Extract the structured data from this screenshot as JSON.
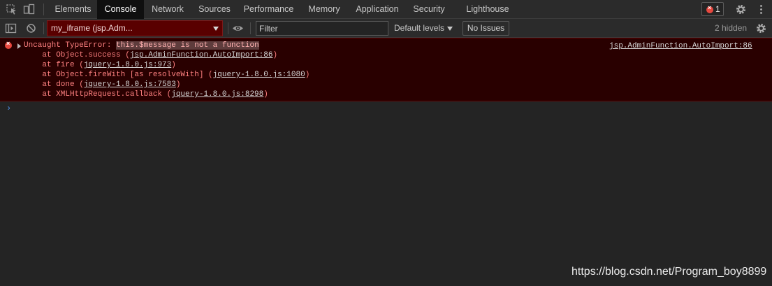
{
  "tabs": [
    {
      "label": "Elements"
    },
    {
      "label": "Console"
    },
    {
      "label": "Network"
    },
    {
      "label": "Sources"
    },
    {
      "label": "Performance"
    },
    {
      "label": "Memory"
    },
    {
      "label": "Application"
    },
    {
      "label": "Security"
    },
    {
      "label": "Lighthouse"
    }
  ],
  "active_tab": "Console",
  "error_badge_count": "1",
  "toolbar": {
    "context": "my_iframe (jsp.Adm...",
    "filter_placeholder": "Filter",
    "levels": "Default levels",
    "issues": "No Issues",
    "hidden": "2 hidden"
  },
  "error": {
    "type": "Uncaught TypeError: ",
    "message": "this.$message is not a function",
    "source": "jsp.AdminFunction.AutoImport:86",
    "stack": [
      {
        "prefix": "    at Object.success (",
        "link": "jsp.AdminFunction.AutoImport:86",
        "suffix": ")"
      },
      {
        "prefix": "    at fire (",
        "link": "jquery-1.8.0.js:973",
        "suffix": ")"
      },
      {
        "prefix": "    at Object.fireWith [as resolveWith] (",
        "link": "jquery-1.8.0.js:1080",
        "suffix": ")"
      },
      {
        "prefix": "    at done (",
        "link": "jquery-1.8.0.js:7583",
        "suffix": ")"
      },
      {
        "prefix": "    at XMLHttpRequest.callback (",
        "link": "jquery-1.8.0.js:8298",
        "suffix": ")"
      }
    ]
  },
  "prompt_symbol": "›",
  "watermark": "https://blog.csdn.net/Program_boy8899",
  "colors": {
    "error_bg": "#290000",
    "error_text": "#ff8080",
    "accent": "#4f8ee6"
  }
}
